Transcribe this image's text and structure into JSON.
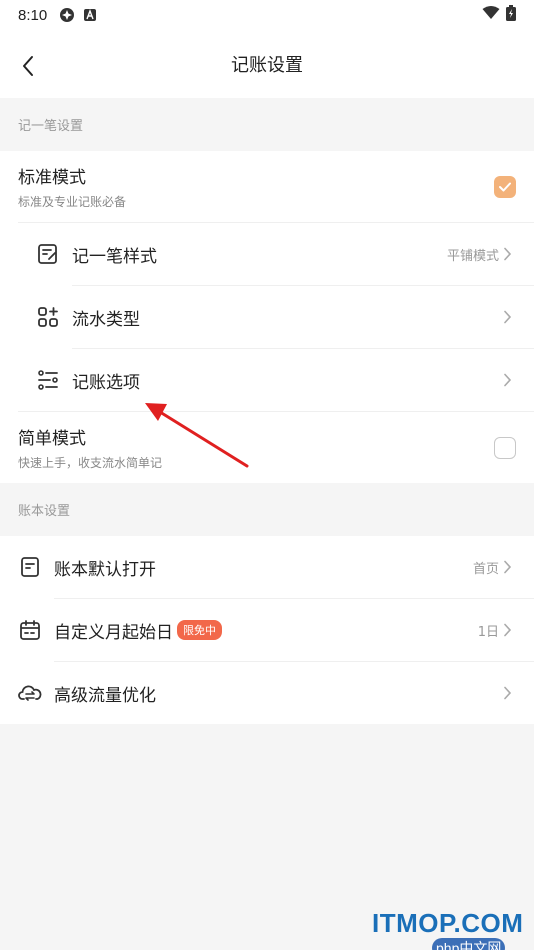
{
  "status_bar": {
    "time": "8:10"
  },
  "nav": {
    "title": "记账设置"
  },
  "section1": {
    "header": "记一笔设置"
  },
  "standard_mode": {
    "title": "标准模式",
    "subtitle": "标准及专业记账必备",
    "checked": true
  },
  "sub_items": [
    {
      "label": "记一笔样式",
      "value": "平铺模式",
      "icon": "edit-icon"
    },
    {
      "label": "流水类型",
      "value": "",
      "icon": "grid-plus-icon"
    },
    {
      "label": "记账选项",
      "value": "",
      "icon": "sliders-icon"
    }
  ],
  "simple_mode": {
    "title": "简单模式",
    "subtitle": "快速上手，收支流水简单记",
    "checked": false
  },
  "section2": {
    "header": "账本设置"
  },
  "book_items": [
    {
      "label": "账本默认打开",
      "value": "首页",
      "icon": "document-icon"
    },
    {
      "label": "自定义月起始日",
      "badge": "限免中",
      "value": "1日",
      "icon": "calendar-icon"
    },
    {
      "label": "高级流量优化",
      "value": "",
      "icon": "cloud-sync-icon"
    }
  ],
  "watermark": {
    "text": "ITMOP.COM",
    "sub": "php中文网"
  },
  "colors": {
    "accent": "#f3b27a",
    "badge": "#f2684a",
    "annotation_arrow": "#e02020"
  }
}
